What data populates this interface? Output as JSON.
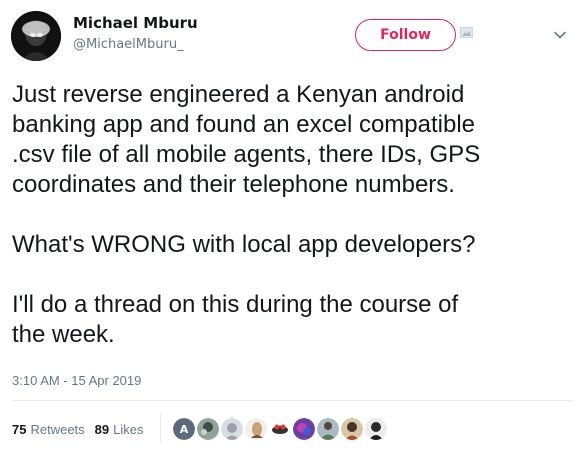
{
  "user": {
    "name": "Michael Mburu",
    "handle": "@MichaelMburu_"
  },
  "follow_label": "Follow",
  "tweet": {
    "paragraphs": [
      [
        "Just reverse engineered a Kenyan android",
        "banking app and found an excel compatible",
        ".csv file of all mobile agents, there IDs, GPS",
        "coordinates and their telephone numbers."
      ],
      [
        "What's WRONG with local app developers?"
      ],
      [
        "I'll do a thread on this during the course of",
        "the week."
      ]
    ],
    "timestamp": "3:10 AM - 15 Apr 2019"
  },
  "stats": {
    "retweets_count": "75",
    "retweets_label": "Retweets",
    "likes_count": "89",
    "likes_label": "Likes"
  },
  "colors": {
    "follow_accent": "#e0245e",
    "text_primary": "#14171a",
    "text_secondary": "#657786",
    "divider": "#e6ecf0"
  },
  "icons": {
    "menu": "chevron-down-icon",
    "card": "image-thumbnail-icon"
  }
}
